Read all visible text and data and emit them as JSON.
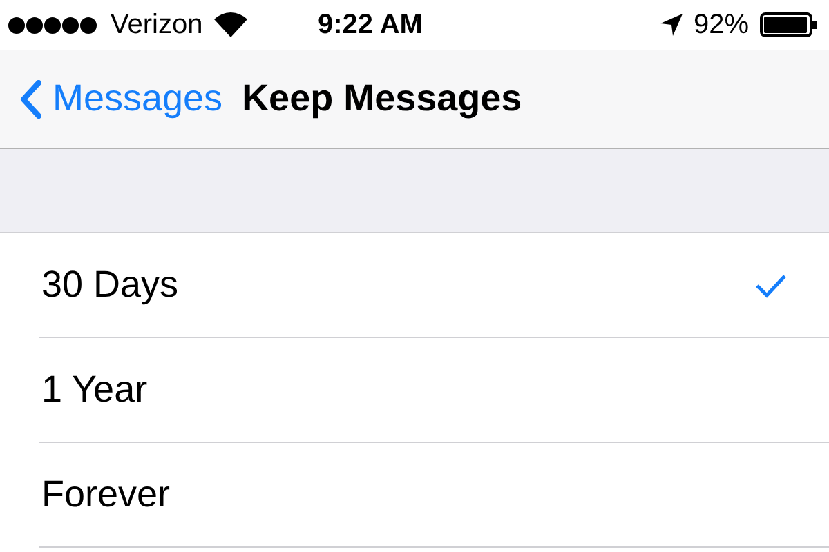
{
  "status_bar": {
    "carrier": "Verizon",
    "time": "9:22 AM",
    "battery": "92%"
  },
  "nav": {
    "back": "Messages",
    "title": "Keep Messages"
  },
  "options": [
    {
      "label": "30 Days",
      "selected": true
    },
    {
      "label": "1 Year",
      "selected": false
    },
    {
      "label": "Forever",
      "selected": false
    }
  ]
}
